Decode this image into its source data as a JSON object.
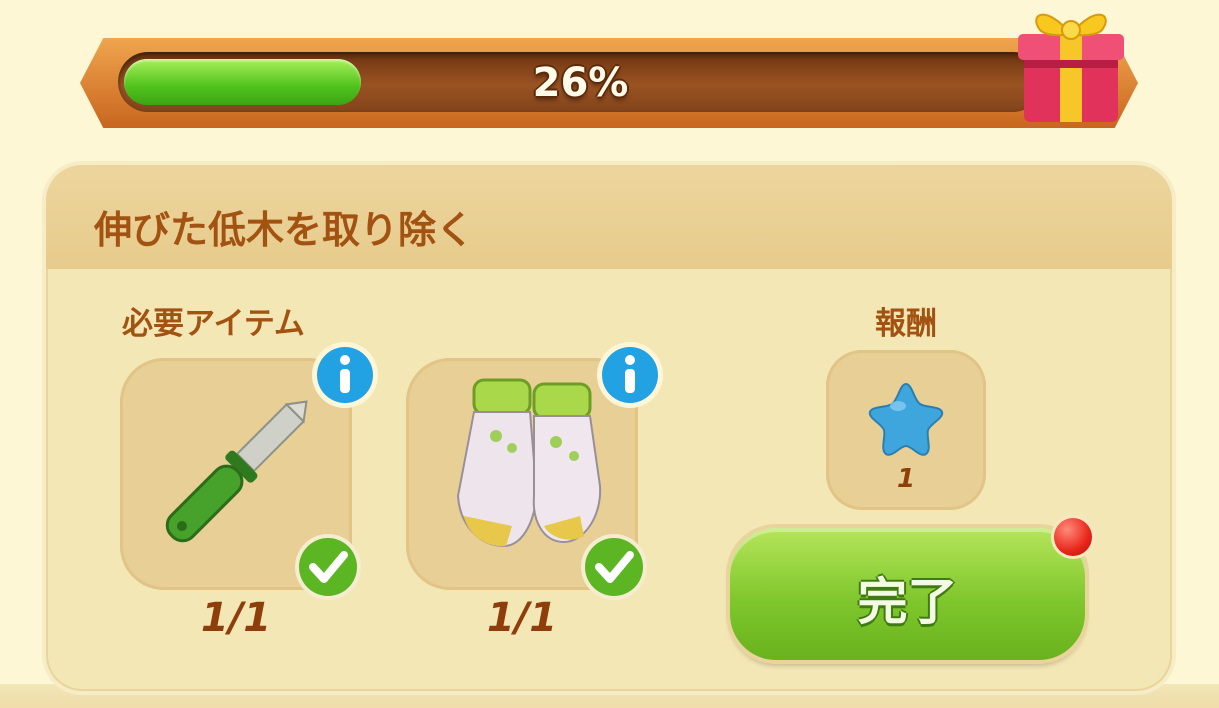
{
  "progress": {
    "value_percent": 26,
    "label": "26%"
  },
  "task": {
    "title": "伸びた低木を取り除く"
  },
  "required_items": {
    "label": "必要アイテム",
    "items": [
      {
        "icon": "pruning-knife-icon",
        "count": "1/1",
        "completed": true
      },
      {
        "icon": "garden-gloves-icon",
        "count": "1/1",
        "completed": true
      }
    ]
  },
  "reward": {
    "label": "報酬",
    "icon": "blue-star-icon",
    "count": "1"
  },
  "complete_button": {
    "label": "完了"
  },
  "colors": {
    "accent_green": "#7fc72c",
    "text_brown": "#a25312",
    "progress_green": "#4fc21c"
  }
}
